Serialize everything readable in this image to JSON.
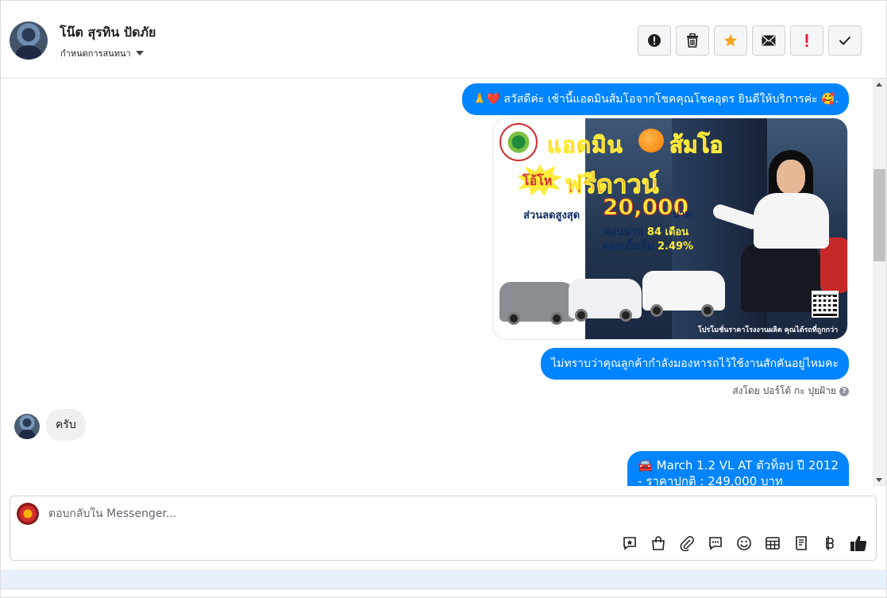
{
  "header": {
    "contact_name": "โน๊ต สุรทิน ปัดภัย",
    "assign_label": "กำหนดการสนทนา",
    "toolbar_icons": [
      "exclamation-circle-icon",
      "trash-icon",
      "star-icon",
      "mail-icon",
      "important-icon",
      "check-icon"
    ],
    "star_color": "#f5a623",
    "important_color": "#e41e3f"
  },
  "messages": {
    "outgoing_1": "🙏❤️ สวัสดีค่ะ เช้านี้แอดมินส้มโอจากโชคคุณโชคอุดร ยินดีให้บริการค่ะ 🥰.",
    "promo": {
      "title_admin": "แอดมิน",
      "title_name": "ส้มโอ",
      "ohai": "โอ้โห",
      "free_down": "ฟรีดาวน์",
      "discount_label": "ส่วนลดสูงสุด",
      "discount_amount": "20,000",
      "baht": "บาท",
      "installment_prefix": "ผ่อนนาน",
      "installment_months": "84 เดือน",
      "interest_prefix": "ดอกเบี้ยเริ่ม",
      "interest_rate": "2.49%",
      "footer": "โปรโมชั่นราคาโรงงานผลิต คุณได้รถที่ถูกกว่า"
    },
    "outgoing_2": "ไม่ทราบว่าคุณลูกค้ากำลังมองหารถไว้ใช้งานสักคันอยู่ไหมคะ",
    "sent_by": "ส่งโดย ปอร์โต้ กะ ปุยฝ้าย",
    "incoming_1": "ครับ",
    "outgoing_3_line1": "🚘 March 1.2 VL AT ตัวท็อป ปี 2012",
    "outgoing_3_line2": "- ราคาปกติ : 249,000 บาท"
  },
  "composer": {
    "placeholder": "ตอบกลับใน Messenger...",
    "tool_icons": [
      "saved-reply-icon",
      "shopping-bag-icon",
      "attachment-icon",
      "quick-reply-icon",
      "emoji-icon",
      "table-icon",
      "receipt-icon",
      "baht-icon",
      "like-icon"
    ]
  },
  "colors": {
    "accent": "#0084ff",
    "bubble_in": "#f1f0f0"
  }
}
